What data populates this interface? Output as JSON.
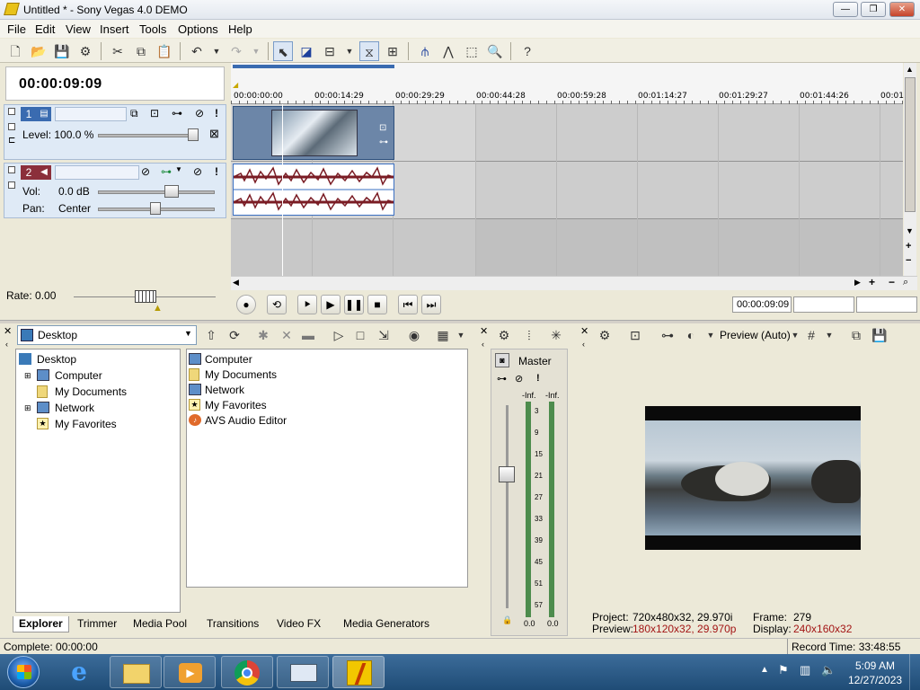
{
  "window": {
    "title": "Untitled * - Sony Vegas 4.0 DEMO",
    "min": "—",
    "max": "❐",
    "close": "✕"
  },
  "menu": [
    "File",
    "Edit",
    "View",
    "Insert",
    "Tools",
    "Options",
    "Help"
  ],
  "time_display": "00:00:09:09",
  "tracks": {
    "video": {
      "number": "1",
      "level_label": "Level: 100.0 %"
    },
    "audio": {
      "number": "2",
      "vol_label": "Vol:",
      "vol_value": "0.0 dB",
      "pan_label": "Pan:",
      "pan_value": "Center"
    }
  },
  "ruler_ticks": [
    "00:00:00:00",
    "00:00:14:29",
    "00:00:29:29",
    "00:00:44:28",
    "00:00:59:28",
    "00:01:14:27",
    "00:01:29:27",
    "00:01:44:26",
    "00:01"
  ],
  "rate": "Rate: 0.00",
  "transport_time": "00:00:09:09",
  "explorer": {
    "path": "Desktop",
    "tree": [
      "Desktop",
      "Computer",
      "My Documents",
      "Network",
      "My Favorites"
    ],
    "files": [
      "Computer",
      "My Documents",
      "Network",
      "My Favorites",
      "AVS Audio Editor"
    ],
    "tabs": [
      "Explorer",
      "Trimmer",
      "Media Pool",
      "Transitions",
      "Video FX",
      "Media Generators"
    ]
  },
  "mixer": {
    "label": "Master",
    "inf_left": "-Inf.",
    "inf_right": "-Inf.",
    "scale": [
      "3",
      "9",
      "15",
      "21",
      "27",
      "33",
      "39",
      "45",
      "51",
      "57"
    ],
    "bottom_left": "0.0",
    "bottom_right": "0.0"
  },
  "preview": {
    "mode": "Preview (Auto)",
    "project_label": "Project:",
    "project_value": "720x480x32, 29.970i",
    "preview_label": "Preview:",
    "preview_value": "180x120x32, 29.970p",
    "frame_label": "Frame:",
    "frame_value": "279",
    "display_label": "Display:",
    "display_value": "240x160x32"
  },
  "status": {
    "left": "Complete: 00:00:00",
    "right": "Record Time: 33:48:55"
  },
  "taskbar": {
    "time": "5:09 AM",
    "date": "12/27/2023"
  }
}
